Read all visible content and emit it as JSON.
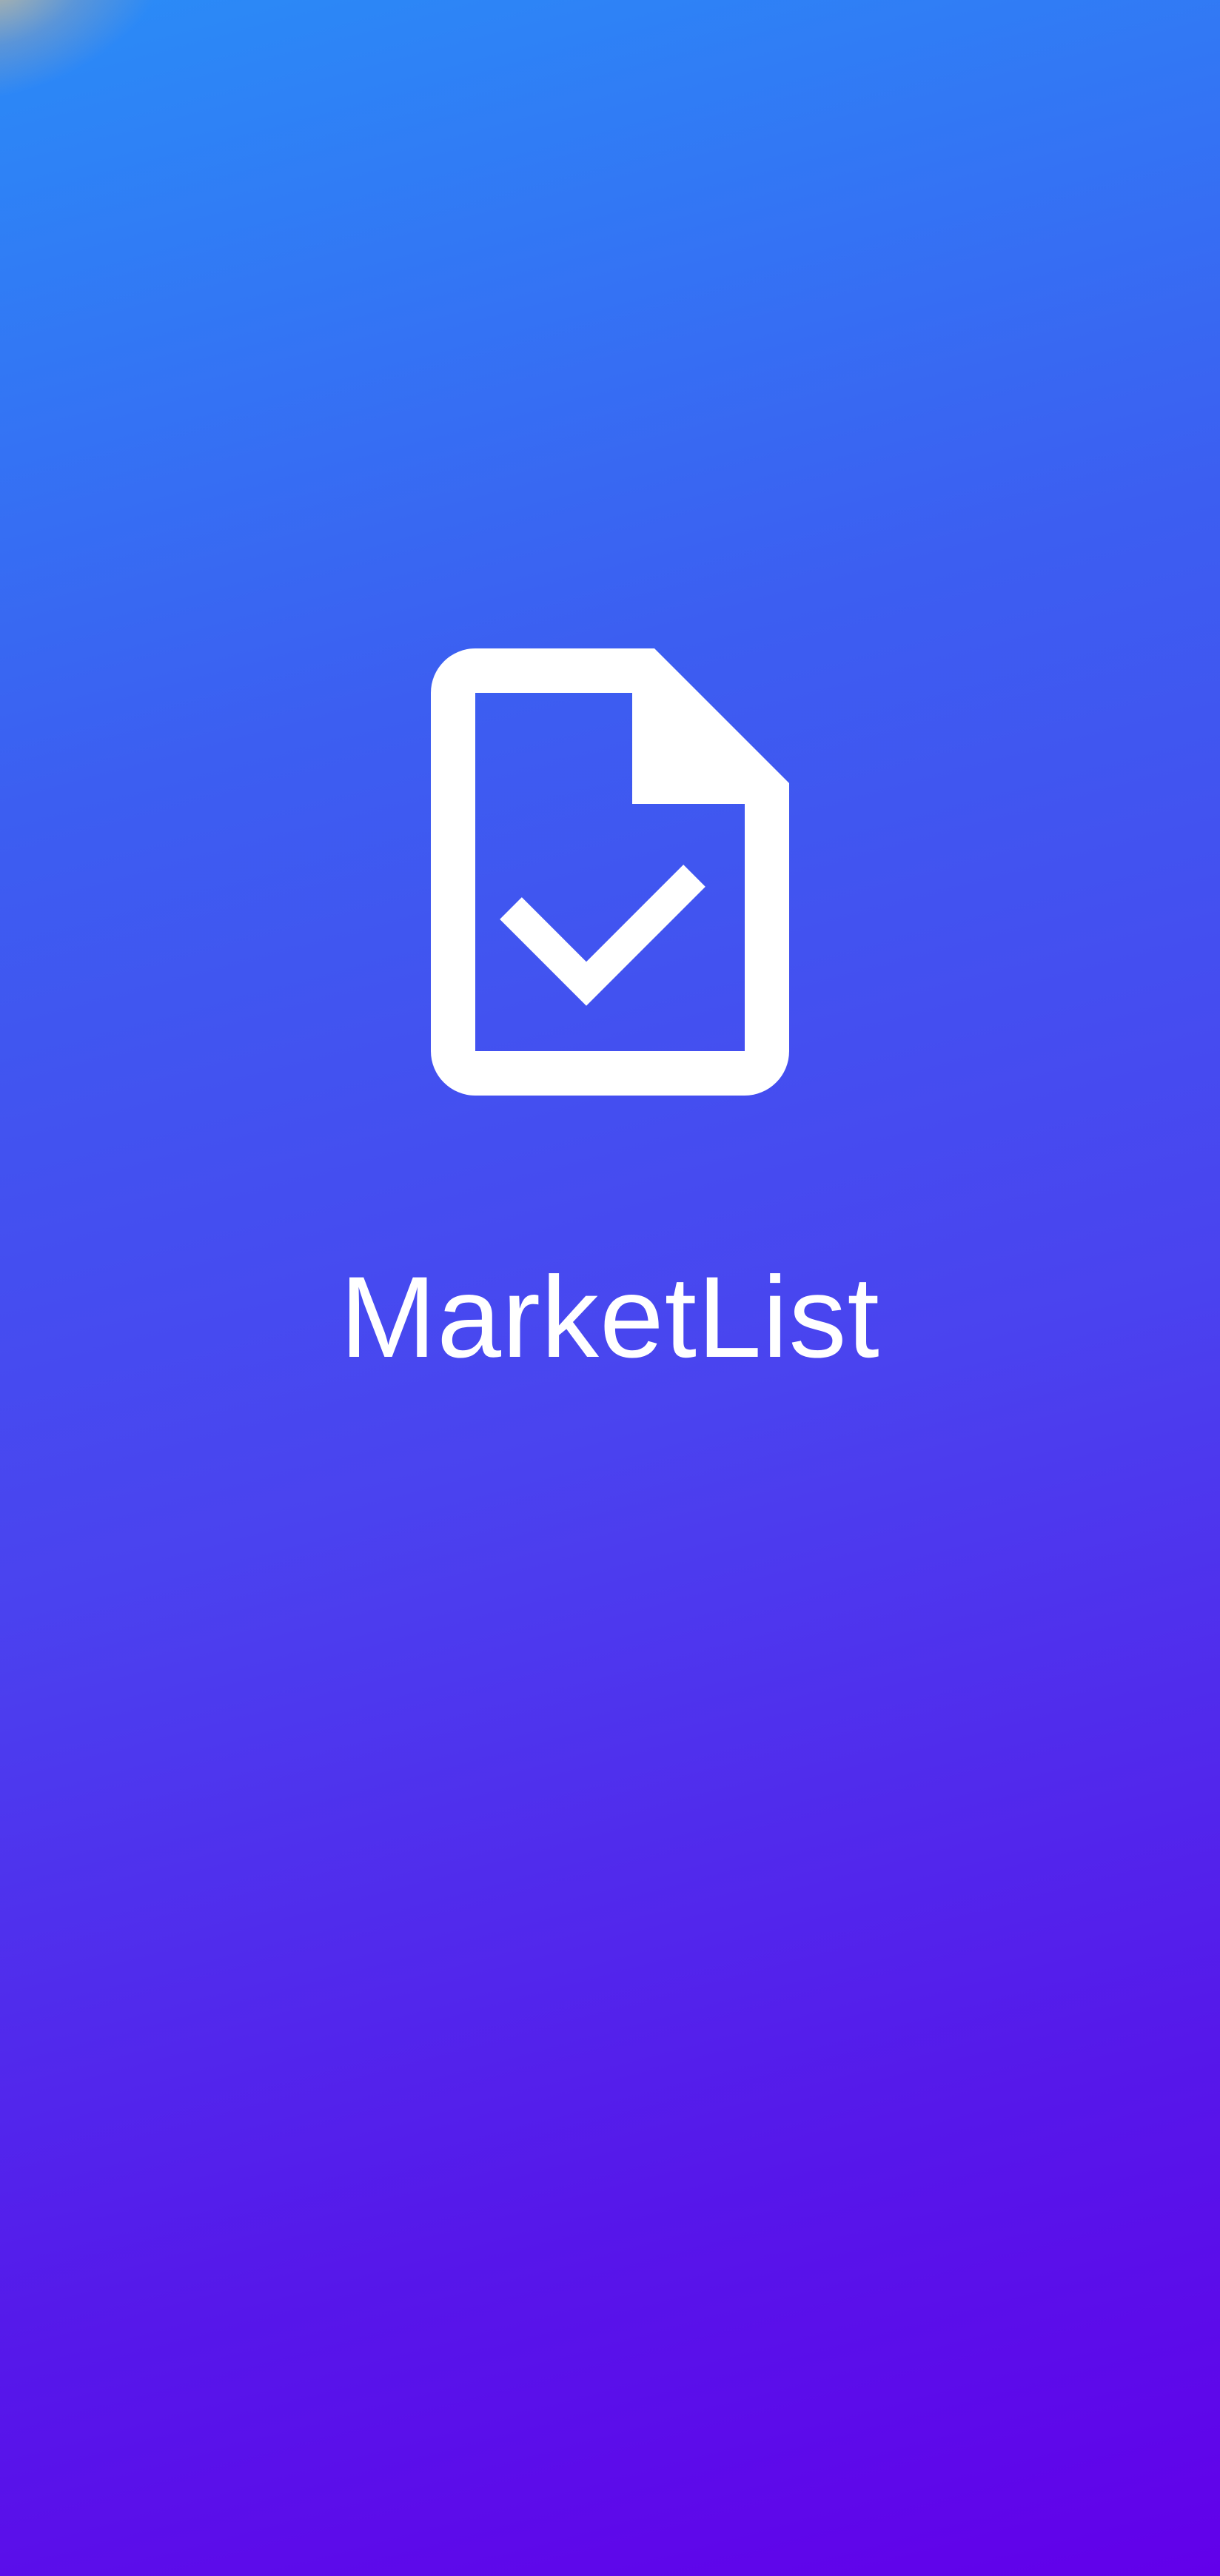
{
  "splash": {
    "app_name": "MarketList",
    "logo_icon": "document-check-icon",
    "colors": {
      "gradient_start": "#2a8cf7",
      "gradient_end": "#6200ea",
      "foreground": "#ffffff"
    }
  }
}
